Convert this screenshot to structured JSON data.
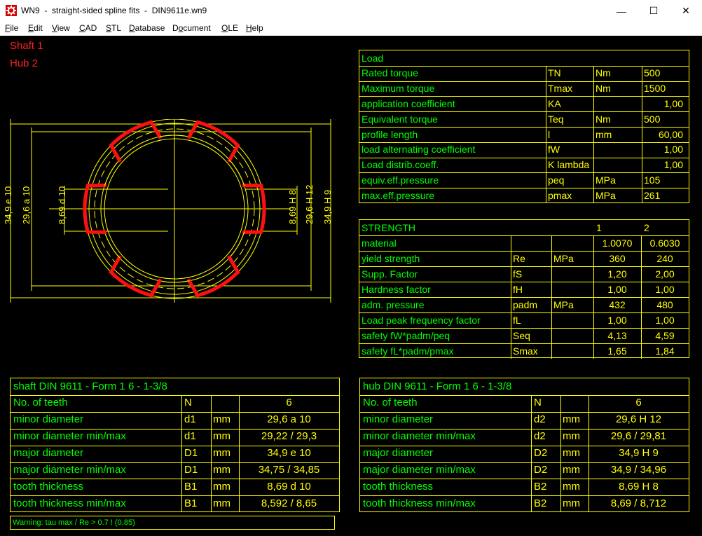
{
  "window": {
    "title": "WN9  -  straight-sided spline fits  -  DIN9611e.wn9",
    "minimize_glyph": "—",
    "maximize_glyph": "☐",
    "close_glyph": "✕"
  },
  "menu": [
    {
      "pre": "",
      "ul": "F",
      "post": "ile"
    },
    {
      "pre": "",
      "ul": "E",
      "post": "dit"
    },
    {
      "pre": "",
      "ul": "V",
      "post": "iew"
    },
    {
      "pre": "",
      "ul": "C",
      "post": "AD"
    },
    {
      "pre": "",
      "ul": "S",
      "post": "TL"
    },
    {
      "pre": "",
      "ul": "D",
      "post": "atabase"
    },
    {
      "pre": "D",
      "ul": "o",
      "post": "cument"
    },
    {
      "pre": "",
      "ul": "O",
      "post": "LE"
    },
    {
      "pre": "",
      "ul": "H",
      "post": "elp"
    }
  ],
  "legend": {
    "shaft": "Shaft 1",
    "hub": "Hub 2"
  },
  "drawing": {
    "dim_left_major": "34,9 e 10",
    "dim_left_minor": "29,6 a 10",
    "dim_left_tooth": "8,69 d 10",
    "dim_right_tooth": "8,69 H 8",
    "dim_right_minor": "29,6 H 12",
    "dim_right_major": "34,9 H 9"
  },
  "load": {
    "title": "Load",
    "rows": [
      {
        "label": "Rated torque",
        "sym": "TN",
        "unit": "Nm",
        "value": "500"
      },
      {
        "label": "Maximum torque",
        "sym": "Tmax",
        "unit": "Nm",
        "value": "1500"
      },
      {
        "label": "application coefficient",
        "sym": "KA",
        "unit": "",
        "value": "1,00"
      },
      {
        "label": "Equivalent torque",
        "sym": "Teq",
        "unit": "Nm",
        "value": "500"
      },
      {
        "label": "profile length",
        "sym": "l",
        "unit": "mm",
        "value": "60,00"
      },
      {
        "label": "load alternating coefficient",
        "sym": "fW",
        "unit": "",
        "value": "1,00"
      },
      {
        "label": "Load distrib.coeff.",
        "sym": "K lambda",
        "unit": "",
        "value": "1,00"
      },
      {
        "label": "equiv.eff.pressure",
        "sym": "peq",
        "unit": "MPa",
        "value": "105"
      },
      {
        "label": "max.eff.pressure",
        "sym": "pmax",
        "unit": "MPa",
        "value": "261"
      }
    ]
  },
  "strength": {
    "title": "STRENGTH",
    "col1": "1",
    "col2": "2",
    "rows": [
      {
        "label": "material",
        "sym": "",
        "unit": "",
        "v1": "1.0070",
        "v2": "0.6030"
      },
      {
        "label": "yield strength",
        "sym": "Re",
        "unit": "MPa",
        "v1": "360",
        "v2": "240"
      },
      {
        "label": "Supp. Factor",
        "sym": "fS",
        "unit": "",
        "v1": "1,20",
        "v2": "2,00"
      },
      {
        "label": "Hardness factor",
        "sym": "fH",
        "unit": "",
        "v1": "1,00",
        "v2": "1,00"
      },
      {
        "label": "adm. pressure",
        "sym": "padm",
        "unit": "MPa",
        "v1": "432",
        "v2": "480"
      },
      {
        "label": "Load peak frequency factor",
        "sym": "fL",
        "unit": "",
        "v1": "1,00",
        "v2": "1,00"
      },
      {
        "label": "safety   fW*padm/peq",
        "sym": "Seq",
        "unit": "",
        "v1": "4,13",
        "v2": "4,59"
      },
      {
        "label": "safety   fL*padm/pmax",
        "sym": "Smax",
        "unit": "",
        "v1": "1,65",
        "v2": "1,84"
      }
    ]
  },
  "shaft": {
    "title": "shaft DIN 9611 - Form 1   6 - 1-3/8",
    "rows": [
      {
        "label": "No. of teeth",
        "sym": "N",
        "unit": "",
        "value": "6"
      },
      {
        "label": "minor diameter",
        "sym": "d1",
        "unit": "mm",
        "value": "29,6 a 10"
      },
      {
        "label": "minor diameter min/max",
        "sym": "d1",
        "unit": "mm",
        "value": "29,22 / 29,3"
      },
      {
        "label": "major diameter",
        "sym": "D1",
        "unit": "mm",
        "value": "34,9 e 10"
      },
      {
        "label": "major diameter min/max",
        "sym": "D1",
        "unit": "mm",
        "value": "34,75 / 34,85"
      },
      {
        "label": "tooth thickness",
        "sym": "B1",
        "unit": "mm",
        "value": "8,69 d 10"
      },
      {
        "label": "tooth thickness min/max",
        "sym": "B1",
        "unit": "mm",
        "value": "8,592 / 8,65"
      }
    ]
  },
  "hub": {
    "title": "hub DIN 9611 - Form 1   6 - 1-3/8",
    "rows": [
      {
        "label": "No. of teeth",
        "sym": "N",
        "unit": "",
        "value": "6"
      },
      {
        "label": "minor diameter",
        "sym": "d2",
        "unit": "mm",
        "value": "29,6 H 12"
      },
      {
        "label": "minor diameter min/max",
        "sym": "d2",
        "unit": "mm",
        "value": "29,6 / 29,81"
      },
      {
        "label": "major diameter",
        "sym": "D2",
        "unit": "mm",
        "value": "34,9 H 9"
      },
      {
        "label": "major diameter min/max",
        "sym": "D2",
        "unit": "mm",
        "value": "34,9 / 34,96"
      },
      {
        "label": "tooth thickness",
        "sym": "B2",
        "unit": "mm",
        "value": "8,69 H 8"
      },
      {
        "label": "tooth thickness min/max",
        "sym": "B2",
        "unit": "mm",
        "value": "8,69 / 8,712"
      }
    ]
  },
  "warning": "Warning: tau max / Re > 0.7 ! (0,85)"
}
